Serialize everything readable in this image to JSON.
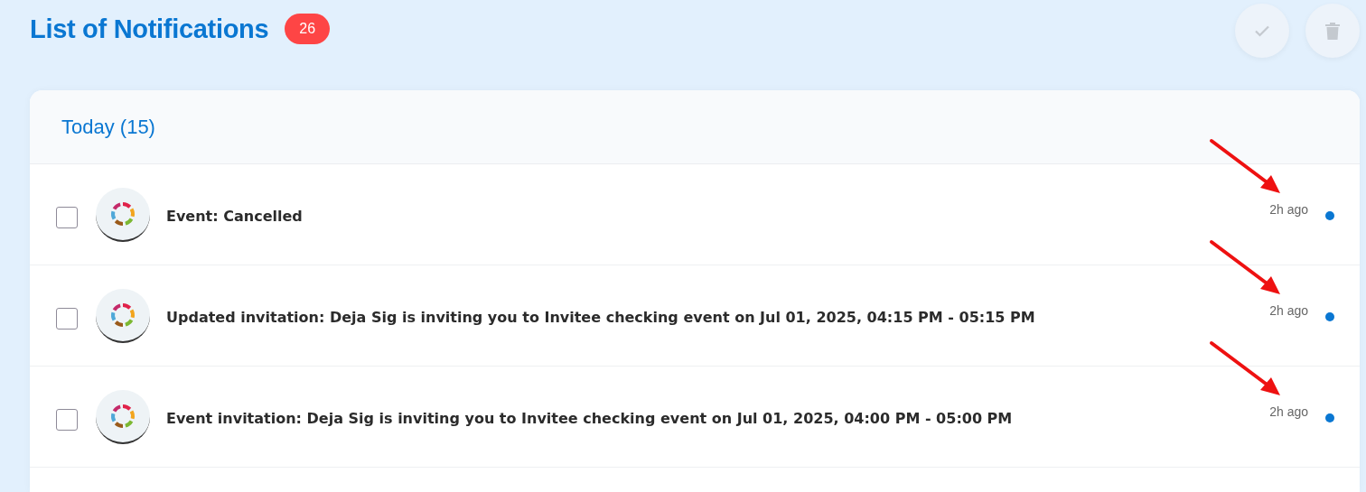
{
  "header": {
    "title": "List of Notifications",
    "count": "26"
  },
  "actions": [
    {
      "kind": "mark-read"
    },
    {
      "kind": "delete"
    }
  ],
  "group": {
    "title": "Today (15)"
  },
  "notifications": [
    {
      "text": "Event: Cancelled",
      "time": "2h ago",
      "checked": false,
      "unread": true,
      "arrow": true
    },
    {
      "text": "Updated invitation: Deja Sig is inviting you to Invitee checking event on Jul 01, 2025, 04:15 PM - 05:15 PM",
      "time": "2h ago",
      "checked": false,
      "unread": true,
      "arrow": true
    },
    {
      "text": "Event invitation: Deja Sig is inviting you to Invitee checking event on Jul 01, 2025, 04:00 PM - 05:00 PM",
      "time": "2h ago",
      "checked": false,
      "unread": true,
      "arrow": true
    }
  ]
}
